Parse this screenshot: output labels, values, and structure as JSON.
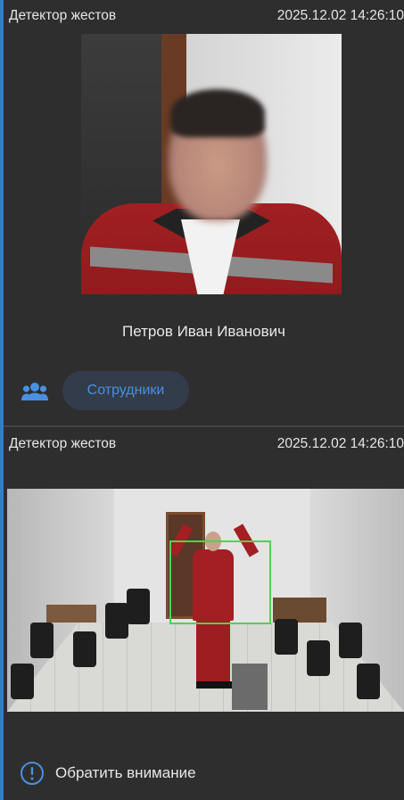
{
  "cards": [
    {
      "header": {
        "title": "Детектор жестов",
        "timestamp": "2025.12.02 14:26:10"
      },
      "person_name": "Петров Иван Иванович",
      "group": {
        "icon": "people-icon",
        "label": "Сотрудники"
      }
    },
    {
      "header": {
        "title": "Детектор жестов",
        "timestamp": "2025.12.02 14:26:10"
      },
      "alert": {
        "icon": "alert-circle-icon",
        "label": "Обратить внимание"
      }
    }
  ],
  "colors": {
    "accent": "#2f7fc8",
    "tag_text": "#4a90e2",
    "tag_bg": "#333c4a",
    "bbox": "#4fd34f",
    "background": "#2b2b2b"
  }
}
